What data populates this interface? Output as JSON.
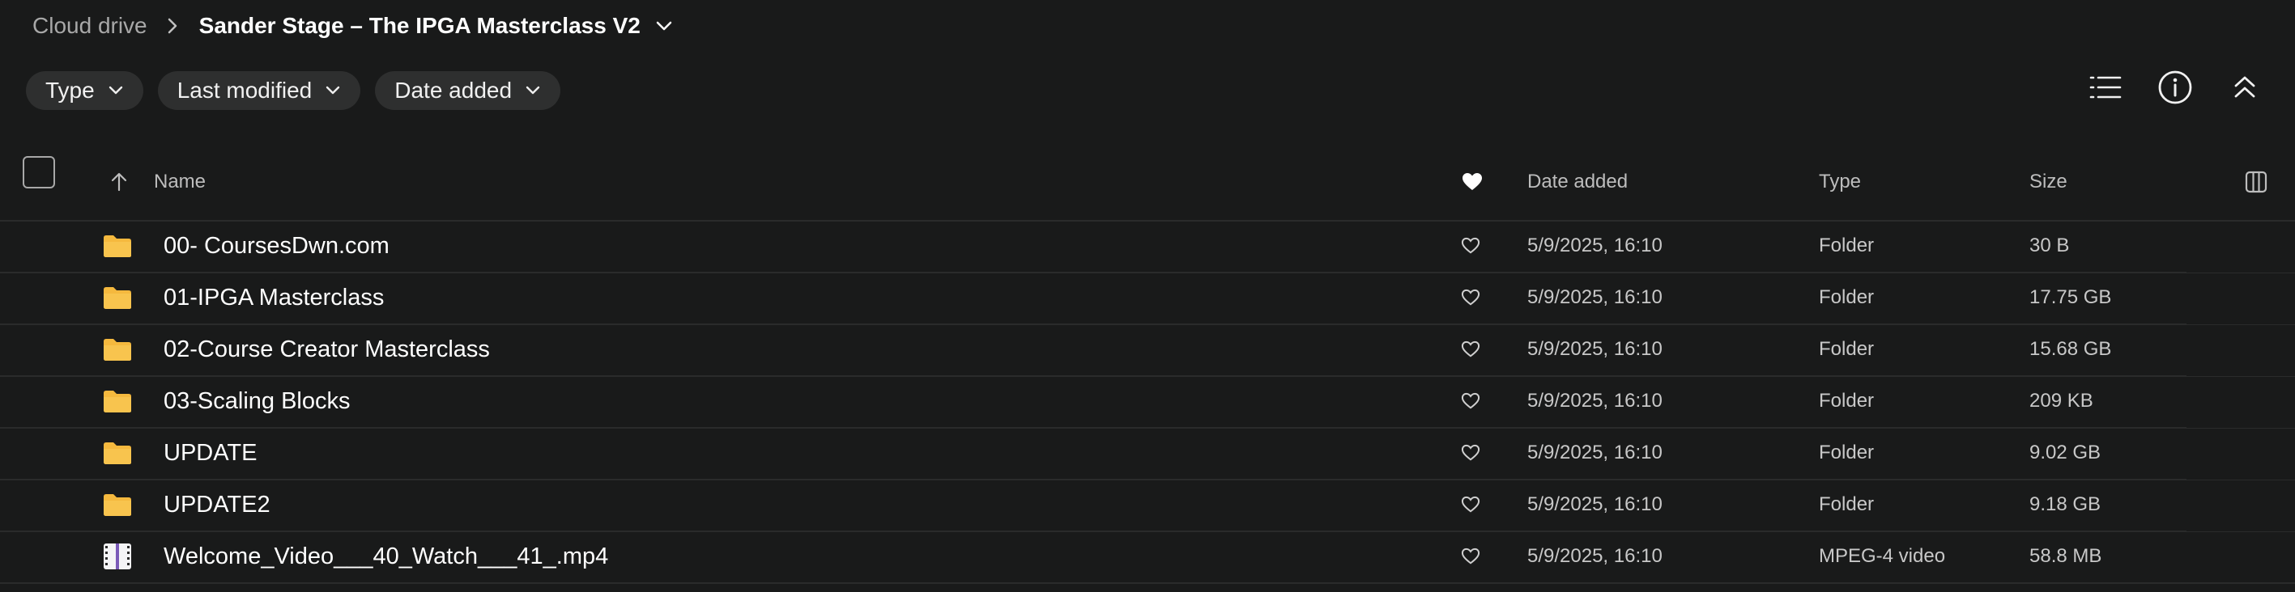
{
  "breadcrumb": {
    "root": "Cloud drive",
    "current": "Sander Stage – The IPGA Masterclass V2"
  },
  "filters": [
    {
      "label": "Type"
    },
    {
      "label": "Last modified"
    },
    {
      "label": "Date added"
    }
  ],
  "toolbar_icons": [
    "list-view-icon",
    "info-icon",
    "collapse-icon"
  ],
  "columns": {
    "name": "Name",
    "date_added": "Date added",
    "type": "Type",
    "size": "Size"
  },
  "rows": [
    {
      "name": "00- CoursesDwn.com",
      "date": "5/9/2025, 16:10",
      "type": "Folder",
      "size": "30 B",
      "icon": "folder-icon"
    },
    {
      "name": "01-IPGA Masterclass",
      "date": "5/9/2025, 16:10",
      "type": "Folder",
      "size": "17.75 GB",
      "icon": "folder-icon"
    },
    {
      "name": "02-Course Creator Masterclass",
      "date": "5/9/2025, 16:10",
      "type": "Folder",
      "size": "15.68 GB",
      "icon": "folder-icon"
    },
    {
      "name": "03-Scaling Blocks",
      "date": "5/9/2025, 16:10",
      "type": "Folder",
      "size": "209 KB",
      "icon": "folder-icon"
    },
    {
      "name": "UPDATE",
      "date": "5/9/2025, 16:10",
      "type": "Folder",
      "size": "9.02 GB",
      "icon": "folder-icon"
    },
    {
      "name": "UPDATE2",
      "date": "5/9/2025, 16:10",
      "type": "Folder",
      "size": "9.18 GB",
      "icon": "folder-icon"
    },
    {
      "name": "Welcome_Video___40_Watch___41_.mp4",
      "date": "5/9/2025, 16:10",
      "type": "MPEG-4 video",
      "size": "58.8 MB",
      "icon": "video-file-icon"
    }
  ],
  "colors": {
    "background": "#191a1a",
    "chip": "#2e2f2f",
    "folder": "#f5b93e",
    "text": "#f2f2f2",
    "muted": "#c8c8c8"
  }
}
